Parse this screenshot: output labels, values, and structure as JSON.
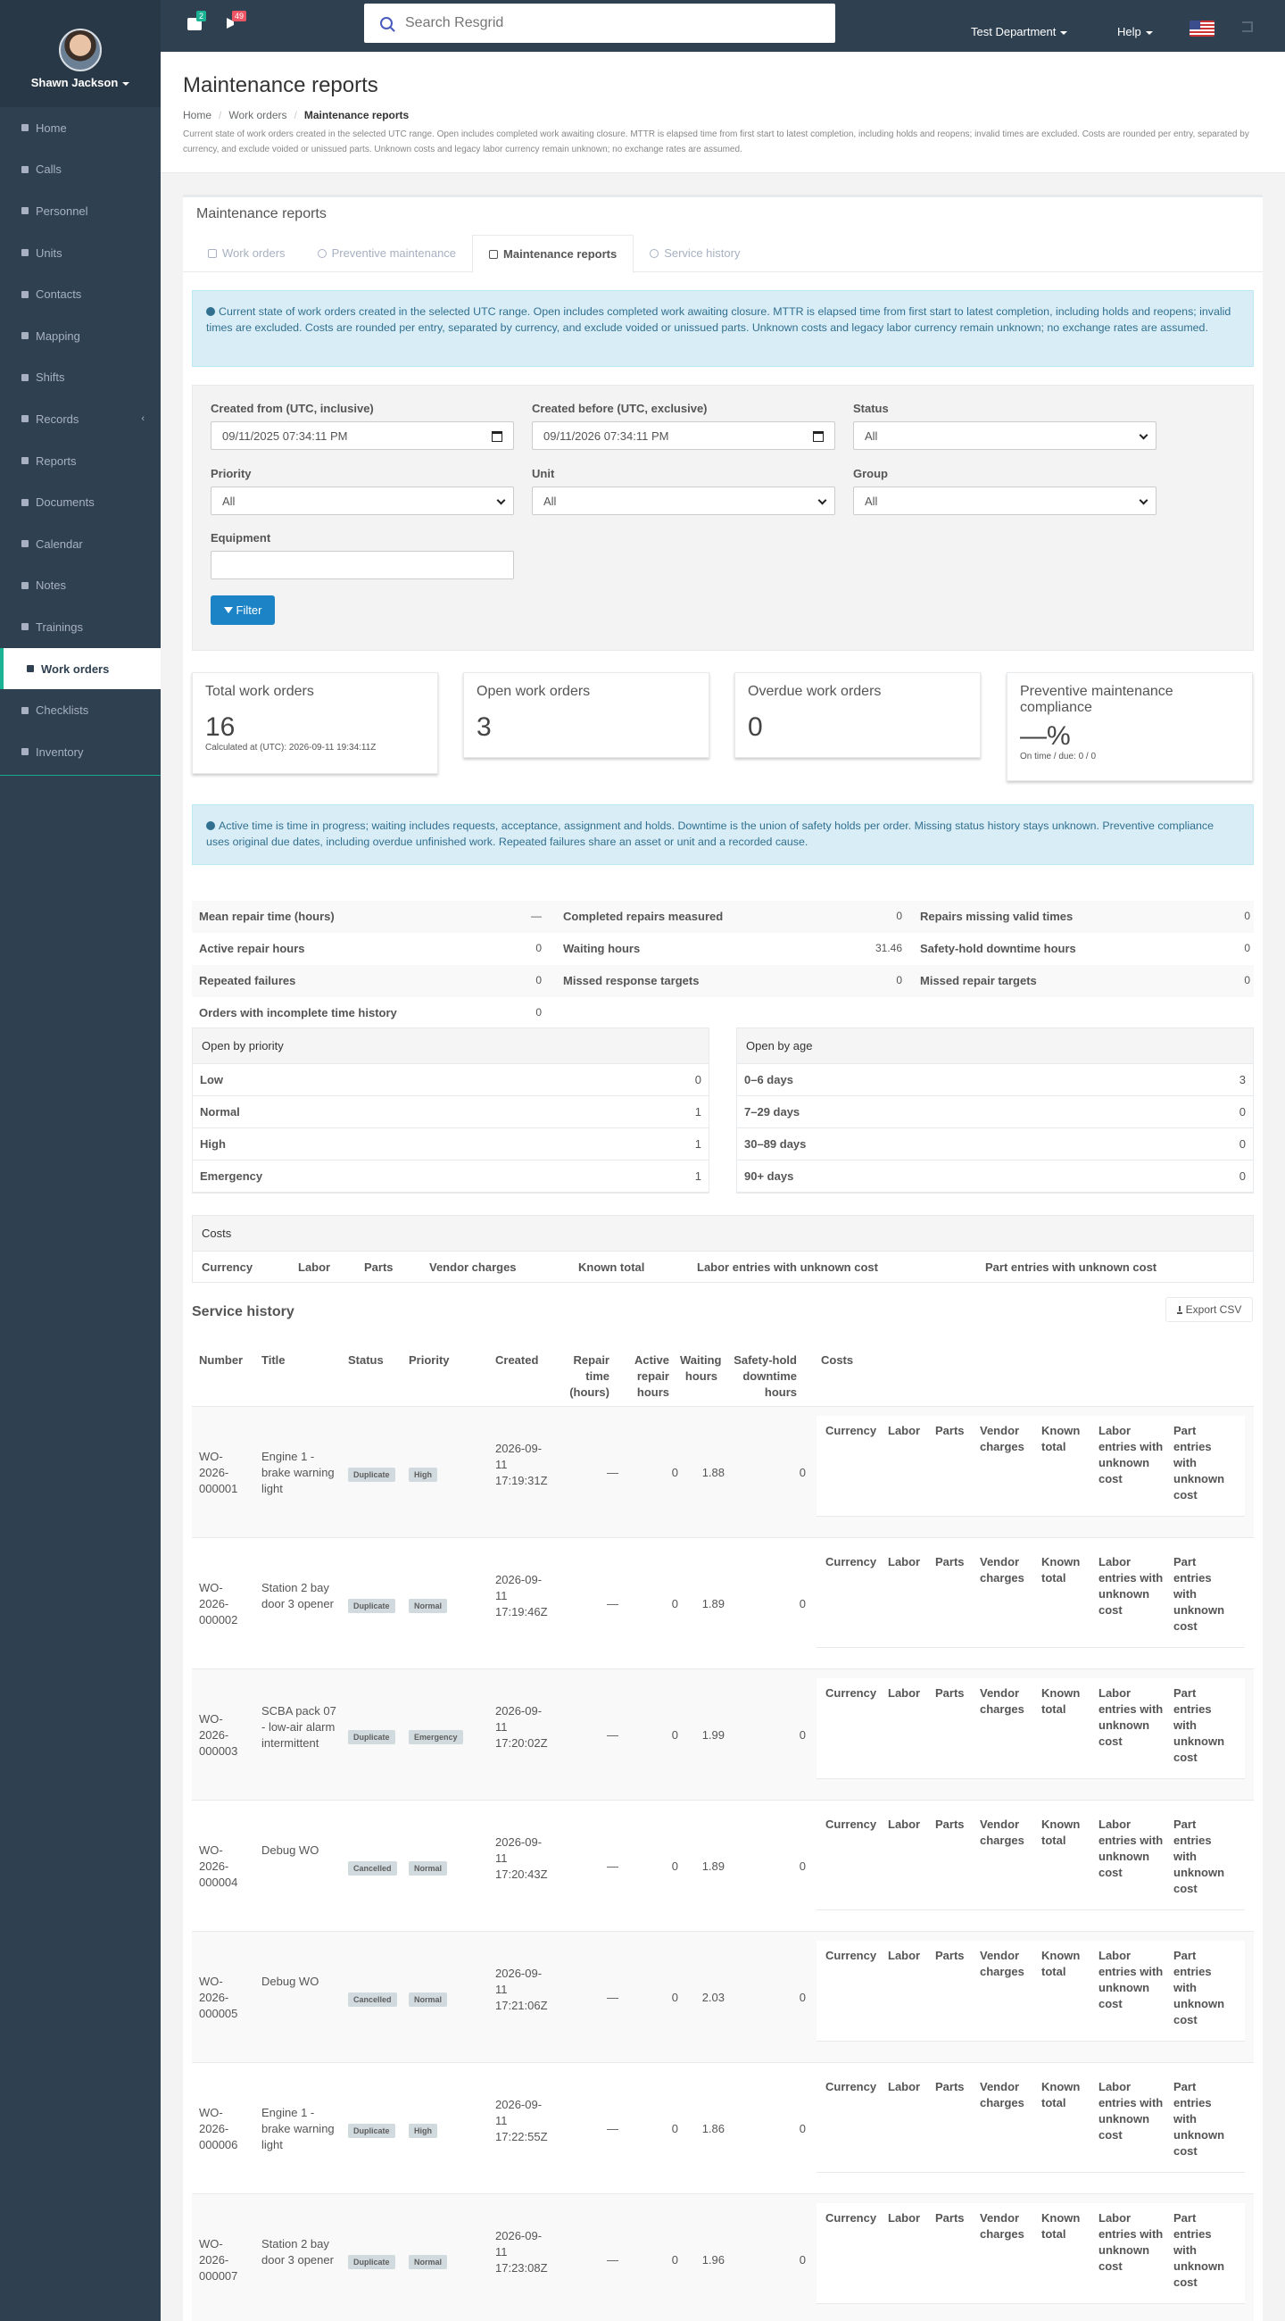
{
  "user": {
    "name": "Shawn Jackson"
  },
  "sidebar": {
    "items": [
      {
        "label": "Home"
      },
      {
        "label": "Calls"
      },
      {
        "label": "Personnel"
      },
      {
        "label": "Units"
      },
      {
        "label": "Contacts"
      },
      {
        "label": "Mapping"
      },
      {
        "label": "Shifts"
      },
      {
        "label": "Records"
      },
      {
        "label": "Reports"
      },
      {
        "label": "Documents"
      },
      {
        "label": "Calendar"
      },
      {
        "label": "Notes"
      },
      {
        "label": "Trainings"
      },
      {
        "label": "Work orders"
      },
      {
        "label": "Checklists"
      },
      {
        "label": "Inventory"
      }
    ]
  },
  "topbar": {
    "messages_badge": "2",
    "notifications_badge": "49",
    "search_placeholder": "Search Resgrid",
    "department": "Test Department",
    "help": "Help"
  },
  "header": {
    "title": "Maintenance reports",
    "breadcrumb": [
      "Home",
      "Work orders",
      "Maintenance reports"
    ],
    "note": "Current state of work orders created in the selected UTC range. Open includes completed work awaiting closure. MTTR is elapsed time from first start to latest completion, including holds and reopens; invalid times are excluded. Costs are rounded per entry, separated by currency, and exclude voided or unissued parts. Unknown costs and legacy labor currency remain unknown; no exchange rates are assumed."
  },
  "box": {
    "title": "Maintenance reports",
    "tabs": [
      "Work orders",
      "Preventive maintenance",
      "Maintenance reports",
      "Service history"
    ],
    "alert": "Current state of work orders created in the selected UTC range. Open includes completed work awaiting closure. MTTR is elapsed time from first start to latest completion, including holds and reopens; invalid times are excluded. Costs are rounded per entry, separated by currency, and exclude voided or unissued parts. Unknown costs and legacy labor currency remain unknown; no exchange rates are assumed."
  },
  "filters": {
    "created_from_label": "Created from (UTC, inclusive)",
    "created_from": "09/11/2025 07:34:11 PM",
    "created_before_label": "Created before (UTC, exclusive)",
    "created_before": "09/11/2026 07:34:11 PM",
    "status_label": "Status",
    "status": "All",
    "priority_label": "Priority",
    "priority": "All",
    "unit_label": "Unit",
    "unit": "All",
    "group_label": "Group",
    "group": "All",
    "equipment_label": "Equipment",
    "equipment": "",
    "button": "Filter"
  },
  "stats": [
    {
      "title": "Total work orders",
      "value": "16",
      "sub": "Calculated at (UTC): 2026-09-11 19:34:11Z"
    },
    {
      "title": "Open work orders",
      "value": "3"
    },
    {
      "title": "Overdue work orders",
      "value": "0"
    },
    {
      "title": "Preventive maintenance compliance",
      "value": "—%",
      "sub": "On time / due: 0 / 0"
    }
  ],
  "alert2": "Active time is time in progress; waiting includes requests, acceptance, assignment and holds. Downtime is the union of safety holds per order. Missing status history stays unknown. Preventive compliance uses original due dates, including overdue unfinished work. Repeated failures share an asset or unit and a recorded cause.",
  "metrics": [
    [
      {
        "label": "Mean repair time (hours)",
        "value": "—"
      },
      {
        "label": "Completed repairs measured",
        "value": "0"
      },
      {
        "label": "Repairs missing valid times",
        "value": "0"
      }
    ],
    [
      {
        "label": "Active repair hours",
        "value": "0"
      },
      {
        "label": "Waiting hours",
        "value": "31.46"
      },
      {
        "label": "Safety-hold downtime hours",
        "value": "0"
      }
    ],
    [
      {
        "label": "Repeated failures",
        "value": "0"
      },
      {
        "label": "Missed response targets",
        "value": "0"
      },
      {
        "label": "Missed repair targets",
        "value": "0"
      }
    ],
    [
      {
        "label": "Orders with incomplete time history",
        "value": "0"
      }
    ]
  ],
  "by_priority": {
    "title": "Open by priority",
    "rows": [
      {
        "label": "Low",
        "value": "0"
      },
      {
        "label": "Normal",
        "value": "1"
      },
      {
        "label": "High",
        "value": "1"
      },
      {
        "label": "Emergency",
        "value": "1"
      }
    ]
  },
  "by_age": {
    "title": "Open by age",
    "rows": [
      {
        "label": "0–6 days",
        "value": "3"
      },
      {
        "label": "7–29 days",
        "value": "0"
      },
      {
        "label": "30–89 days",
        "value": "0"
      },
      {
        "label": "90+ days",
        "value": "0"
      }
    ]
  },
  "costs": {
    "title": "Costs",
    "columns": [
      "Currency",
      "Labor",
      "Parts",
      "Vendor charges",
      "Known total",
      "Labor entries with unknown cost",
      "Part entries with unknown cost"
    ]
  },
  "service_history": {
    "title": "Service history",
    "export": "Export CSV",
    "columns": [
      "Number",
      "Title",
      "Status",
      "Priority",
      "Created",
      "Repair time (hours)",
      "Active repair hours",
      "Waiting hours",
      "Safety-hold downtime hours",
      "Costs"
    ],
    "cost_columns": [
      "Currency",
      "Labor",
      "Parts",
      "Vendor charges",
      "Known total",
      "Labor entries with unknown cost",
      "Part entries with unknown cost"
    ],
    "rows": [
      {
        "number": "WO-2026-000001",
        "title": "Engine 1 - brake warning light",
        "status": "Duplicate",
        "priority": "High",
        "created": "2026-09-11 17:19:31Z",
        "repair": "—",
        "active": "0",
        "waiting": "1.88",
        "downtime": "0"
      },
      {
        "number": "WO-2026-000002",
        "title": "Station 2 bay door 3 opener",
        "status": "Duplicate",
        "priority": "Normal",
        "created": "2026-09-11 17:19:46Z",
        "repair": "—",
        "active": "0",
        "waiting": "1.89",
        "downtime": "0"
      },
      {
        "number": "WO-2026-000003",
        "title": "SCBA pack 07 - low-air alarm intermittent",
        "status": "Duplicate",
        "priority": "Emergency",
        "created": "2026-09-11 17:20:02Z",
        "repair": "—",
        "active": "0",
        "waiting": "1.99",
        "downtime": "0"
      },
      {
        "number": "WO-2026-000004",
        "title": "Debug WO",
        "status": "Cancelled",
        "priority": "Normal",
        "created": "2026-09-11 17:20:43Z",
        "repair": "—",
        "active": "0",
        "waiting": "1.89",
        "downtime": "0"
      },
      {
        "number": "WO-2026-000005",
        "title": "Debug WO",
        "status": "Cancelled",
        "priority": "Normal",
        "created": "2026-09-11 17:21:06Z",
        "repair": "—",
        "active": "0",
        "waiting": "2.03",
        "downtime": "0"
      },
      {
        "number": "WO-2026-000006",
        "title": "Engine 1 - brake warning light",
        "status": "Duplicate",
        "priority": "High",
        "created": "2026-09-11 17:22:55Z",
        "repair": "—",
        "active": "0",
        "waiting": "1.86",
        "downtime": "0"
      },
      {
        "number": "WO-2026-000007",
        "title": "Station 2 bay door 3 opener",
        "status": "Duplicate",
        "priority": "Normal",
        "created": "2026-09-11 17:23:08Z",
        "repair": "—",
        "active": "0",
        "waiting": "1.96",
        "downtime": "0"
      }
    ]
  }
}
